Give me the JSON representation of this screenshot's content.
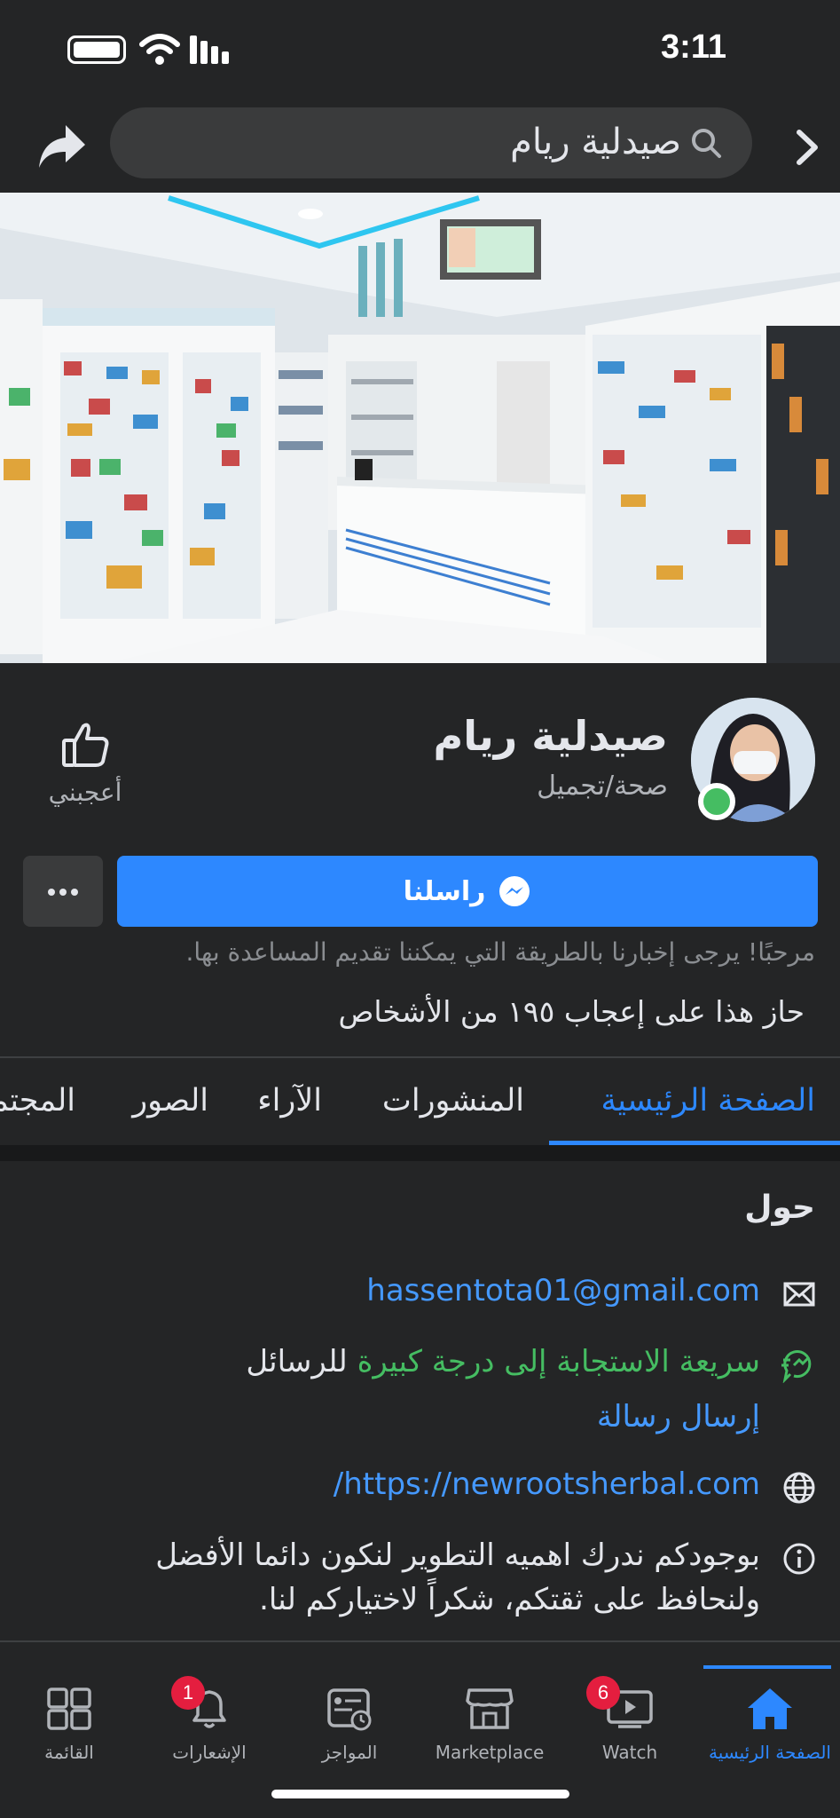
{
  "status_bar": {
    "time": "3:11"
  },
  "header": {
    "search_text": "صيدلية ريام"
  },
  "page": {
    "name": "صيدلية ريام",
    "category": "صحة/تجميل",
    "like_label": "أعجبني",
    "message_label": "راسلنا",
    "greeting": "مرحبًا! يرجى إخبارنا بالطريقة التي يمكننا تقديم المساعدة بها.",
    "likes_count": "حاز هذا على إعجاب ١٩٥ من الأشخاص"
  },
  "tabs": [
    "الصفحة الرئيسية",
    "المنشورات",
    "الآراء",
    "الصور",
    "المجتمع"
  ],
  "about": {
    "title": "حول",
    "email": "hassentota01@gmail.com",
    "response_highlight": "سريعة الاستجابة إلى درجة كبيرة",
    "response_rest": "للرسائل",
    "send_message": "إرسال رسالة",
    "website": "https://newrootsherbal.com/",
    "description_line1": "بوجودكم ندرك اهميه التطوير لنكون دائما الأفضل",
    "description_line2": "ولنحافظ على ثقتكم، شكراً لاختياركم لنا."
  },
  "bottom_nav": {
    "home": "الصفحة الرئيسية",
    "watch": "Watch",
    "watch_badge": "6",
    "marketplace": "Marketplace",
    "bookmarks": "المواجز",
    "notifications": "الإشعارات",
    "notifications_badge": "1",
    "menu": "القائمة"
  },
  "colors": {
    "accent": "#2d88ff",
    "background": "#242526",
    "green": "#45bd62",
    "badge": "#e41e3f"
  }
}
